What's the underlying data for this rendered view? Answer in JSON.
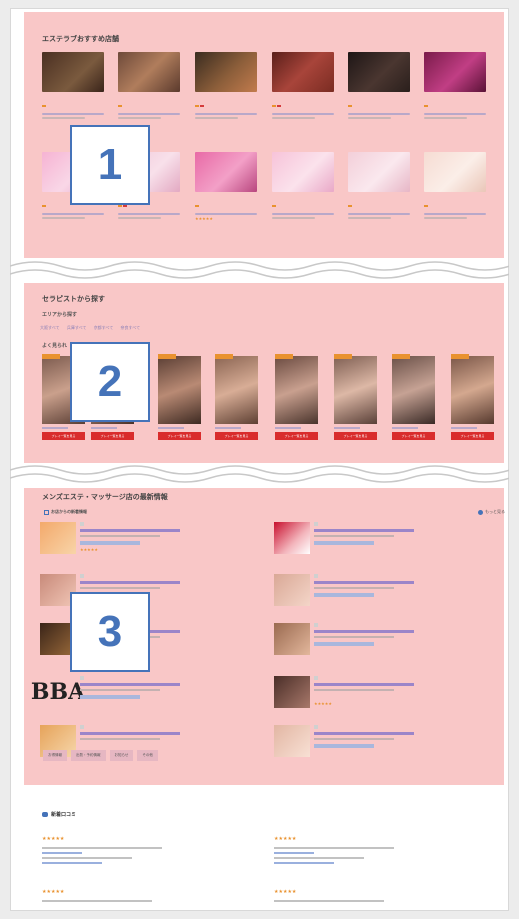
{
  "sections": {
    "shops": {
      "title": "エステラブおすすめ店舗",
      "label_number": "1"
    },
    "therapists": {
      "title": "セラピストから探す",
      "area_title": "エリアから探す",
      "area_links": [
        "大阪すべて",
        "兵庫すべて",
        "京都すべて",
        "奈良すべて"
      ],
      "popular_title": "よく見られ",
      "button_label": "プレイ一覧を見る",
      "label_number": "2"
    },
    "news": {
      "title": "メンズエステ・マッサージ店の最新情報",
      "sub_title": "お店からの新着情報",
      "more_link": "もっと見る",
      "label_number": "3",
      "categories": [
        "お得情報",
        "出勤・予約情報",
        "お知らせ",
        "その他"
      ]
    },
    "reviews": {
      "title": "新着口コミ",
      "review_stars": "★★★★★"
    }
  },
  "colors": {
    "panel_overlay": "#f9c7c7",
    "label_blue": "#4573b9",
    "tag_orange": "#e9922f",
    "button_red": "#d92c2c"
  }
}
